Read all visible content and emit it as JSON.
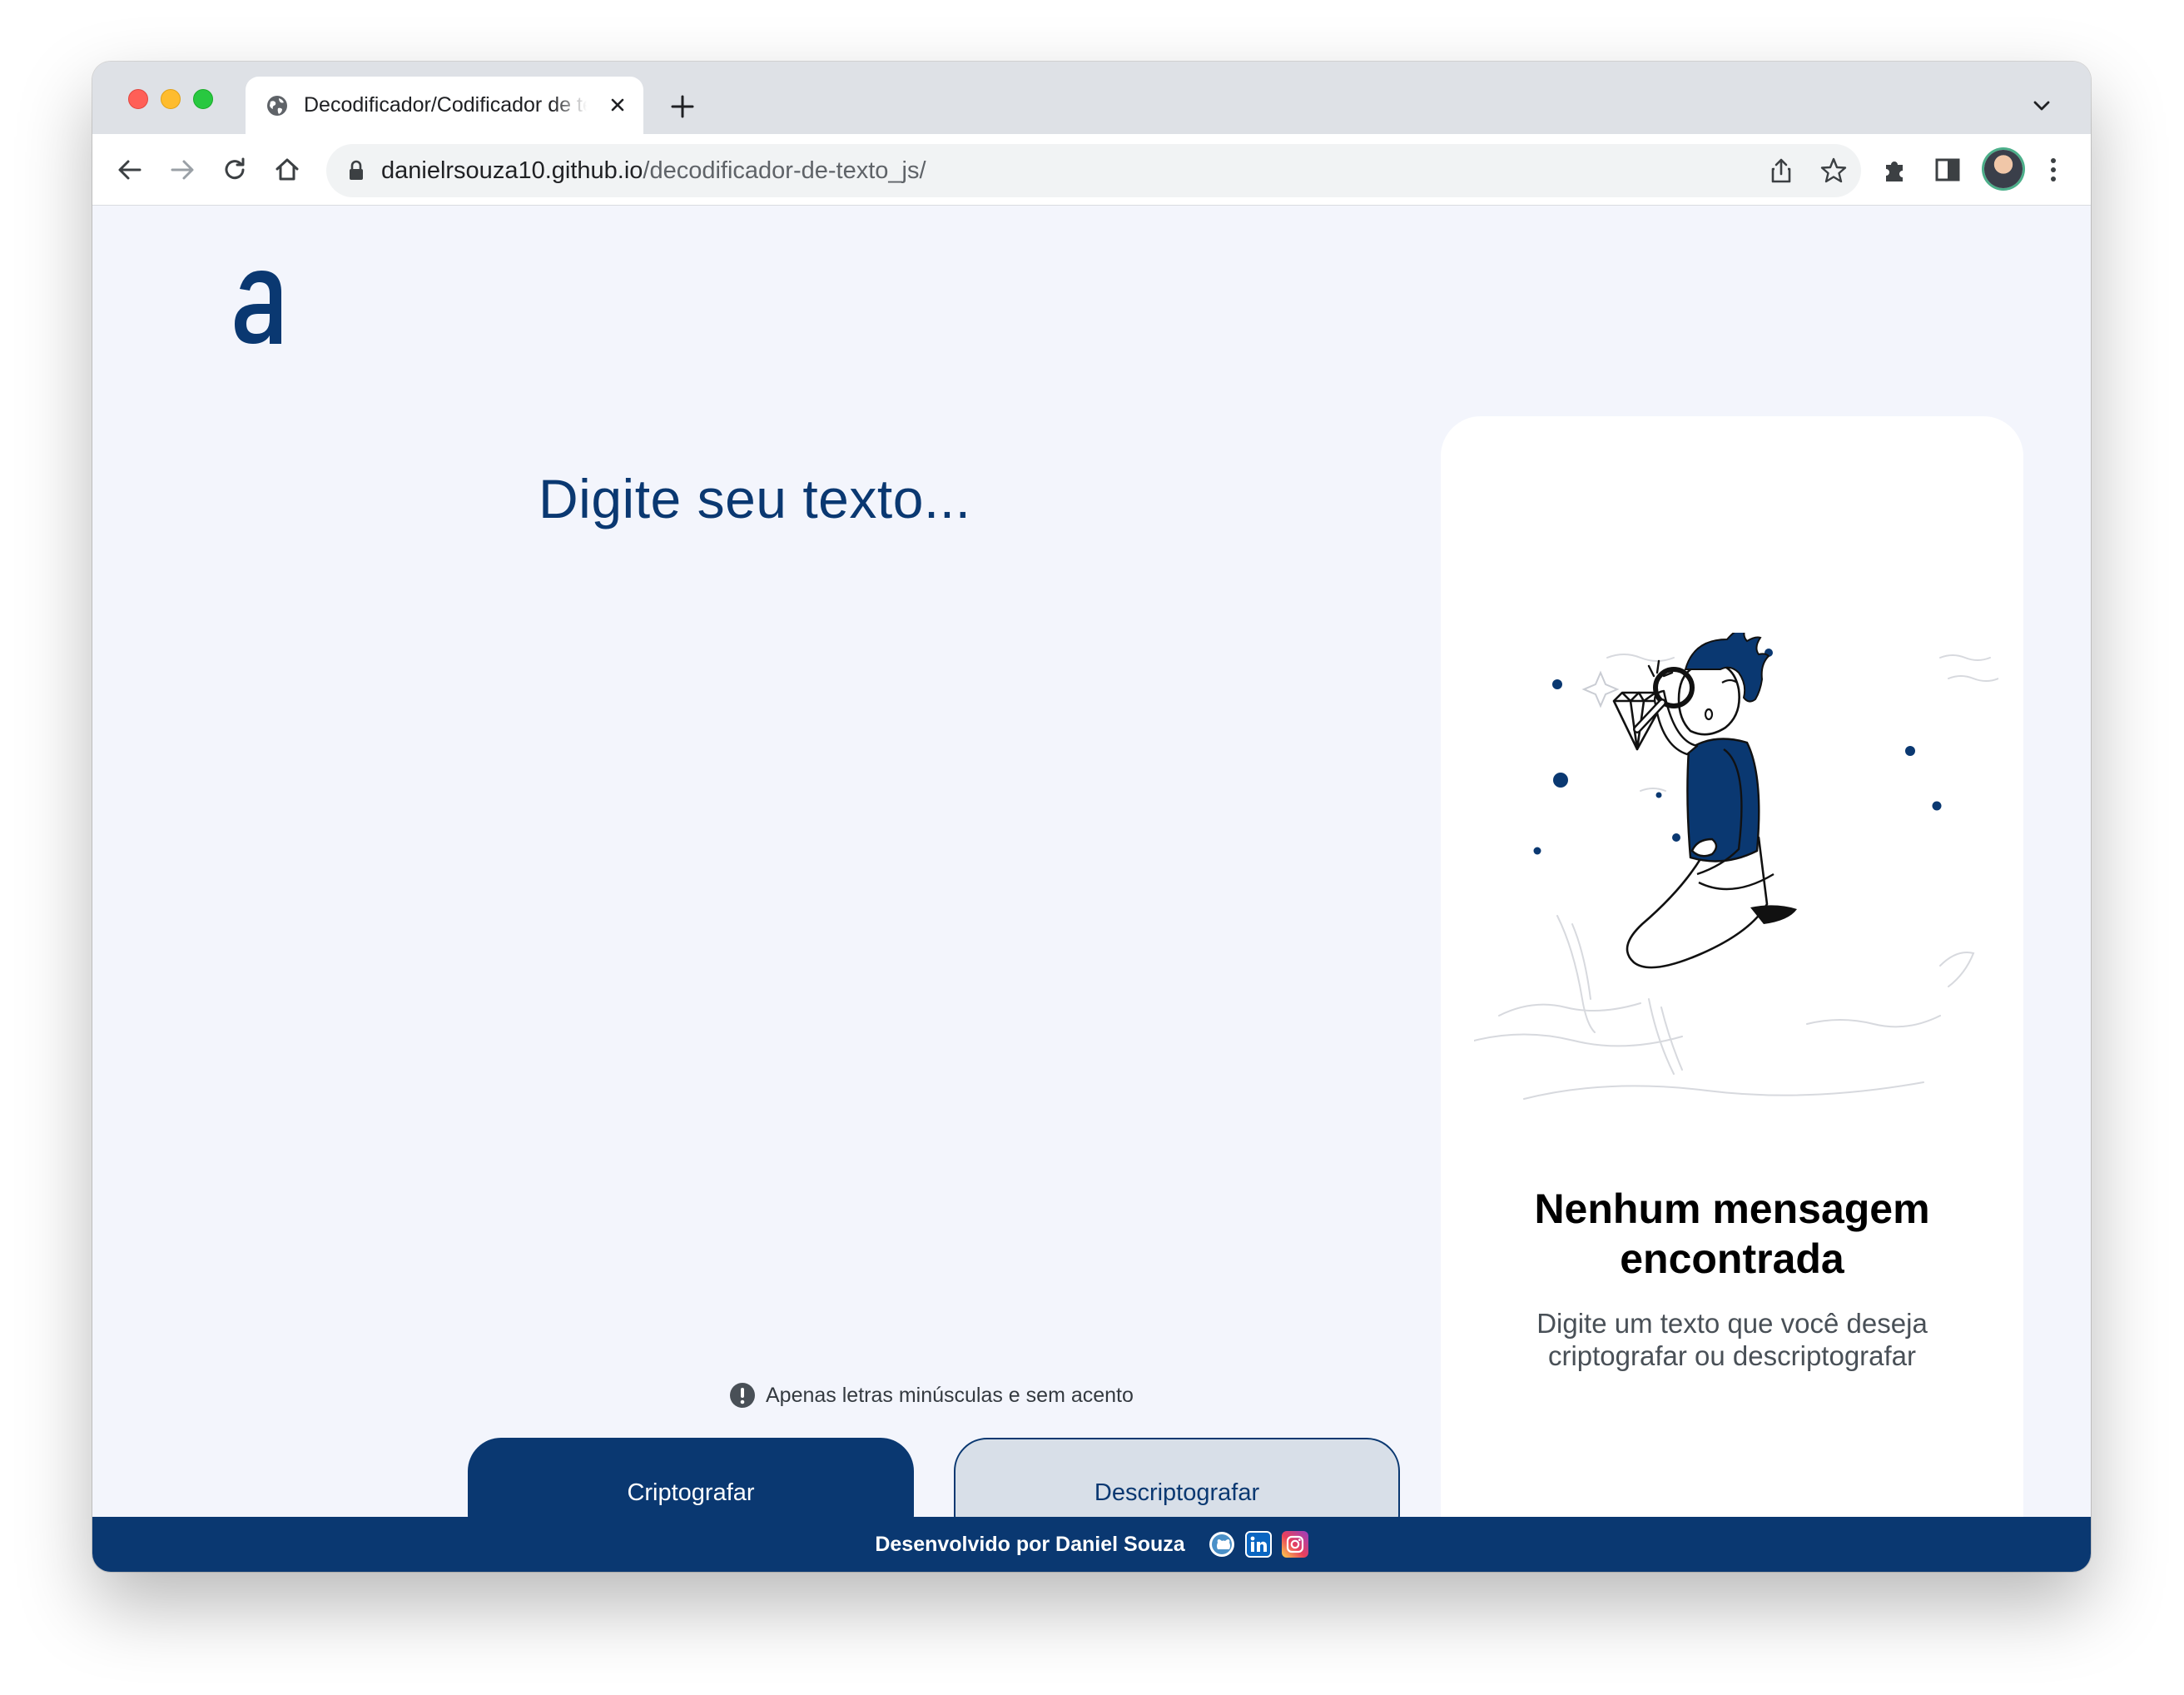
{
  "browser": {
    "tab_title": "Decodificador/Codificador de texto",
    "url_host": "danielrsouza10.github.io",
    "url_path": "/decodificador-de-texto_js/"
  },
  "main": {
    "prompt": "Digite seu texto...",
    "hint": "Apenas letras minúsculas e sem acento",
    "encrypt_label": "Criptografar",
    "decrypt_label": "Descriptografar"
  },
  "output_card": {
    "title_line1": "Nenhum mensagem",
    "title_line2": "encontrada",
    "text": "Digite um texto que você deseja criptografar ou descriptografar"
  },
  "footer": {
    "credit": "Desenvolvido por Daniel Souza",
    "links": [
      "github-icon",
      "linkedin-icon",
      "instagram-icon"
    ]
  },
  "colors": {
    "primary": "#0a3871",
    "page_bg": "#f3f5fc",
    "decrypt_bg": "#d8dfe8"
  }
}
